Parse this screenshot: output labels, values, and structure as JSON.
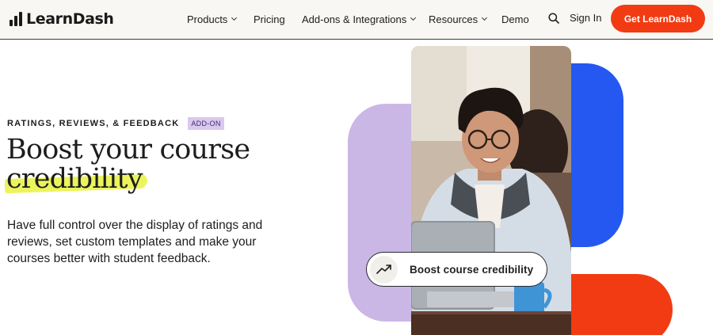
{
  "header": {
    "logo_text": "LearnDash",
    "nav": [
      {
        "label": "Products",
        "has_dropdown": true
      },
      {
        "label": "Pricing",
        "has_dropdown": false
      },
      {
        "label": "Add-ons & Integrations",
        "has_dropdown": true
      },
      {
        "label": "Resources",
        "has_dropdown": true
      },
      {
        "label": "Demo",
        "has_dropdown": false
      }
    ],
    "search_icon": "search-icon",
    "signin_label": "Sign In",
    "cta_label": "Get LearnDash"
  },
  "hero": {
    "eyebrow": "RATINGS, REVIEWS, & FEEDBACK",
    "badge": "ADD-ON",
    "headline_line1": "Boost your course",
    "headline_line2": "credibility",
    "description": "Have full control over the display of ratings and reviews, set custom templates and make your courses better with student feedback.",
    "pill_label": "Boost course credibility",
    "pill_icon": "trending-up-icon"
  },
  "colors": {
    "accent_orange": "#f23b12",
    "accent_blue": "#2458f0",
    "accent_purple": "#cbb7e5",
    "highlight_yellow": "#ecf45c"
  }
}
